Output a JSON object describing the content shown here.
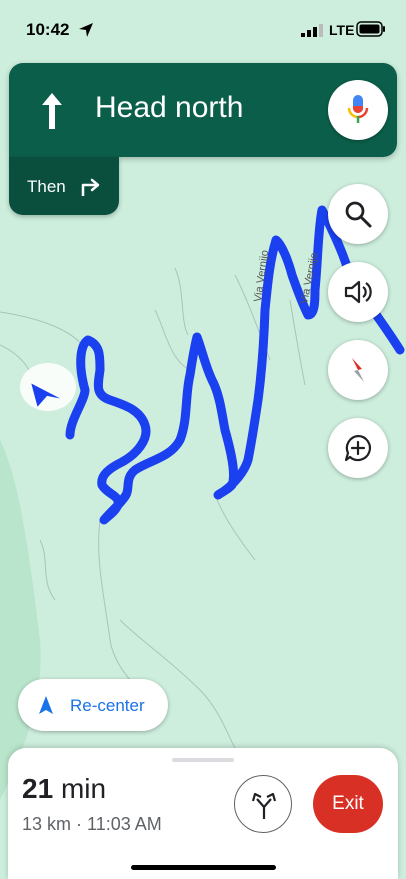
{
  "status_bar": {
    "time": "10:42",
    "network": "LTE"
  },
  "navigation": {
    "instruction": "Head north",
    "then_label": "Then",
    "then_icon": "turn-right-icon"
  },
  "map": {
    "road_labels": [
      "Via Vernijo",
      "Via Vernijo"
    ],
    "buttons": [
      "search-icon",
      "volume-icon",
      "compass-icon",
      "add-report-icon"
    ]
  },
  "recenter": {
    "label": "Re-center"
  },
  "trip": {
    "duration_value": "21",
    "duration_unit": "min",
    "details": "13 km · 11:03 AM",
    "exit_label": "Exit"
  },
  "colors": {
    "nav_green": "#0b5e49",
    "route_blue": "#1a40f0",
    "exit_red": "#d93025",
    "map_background": "#cdeedd"
  }
}
